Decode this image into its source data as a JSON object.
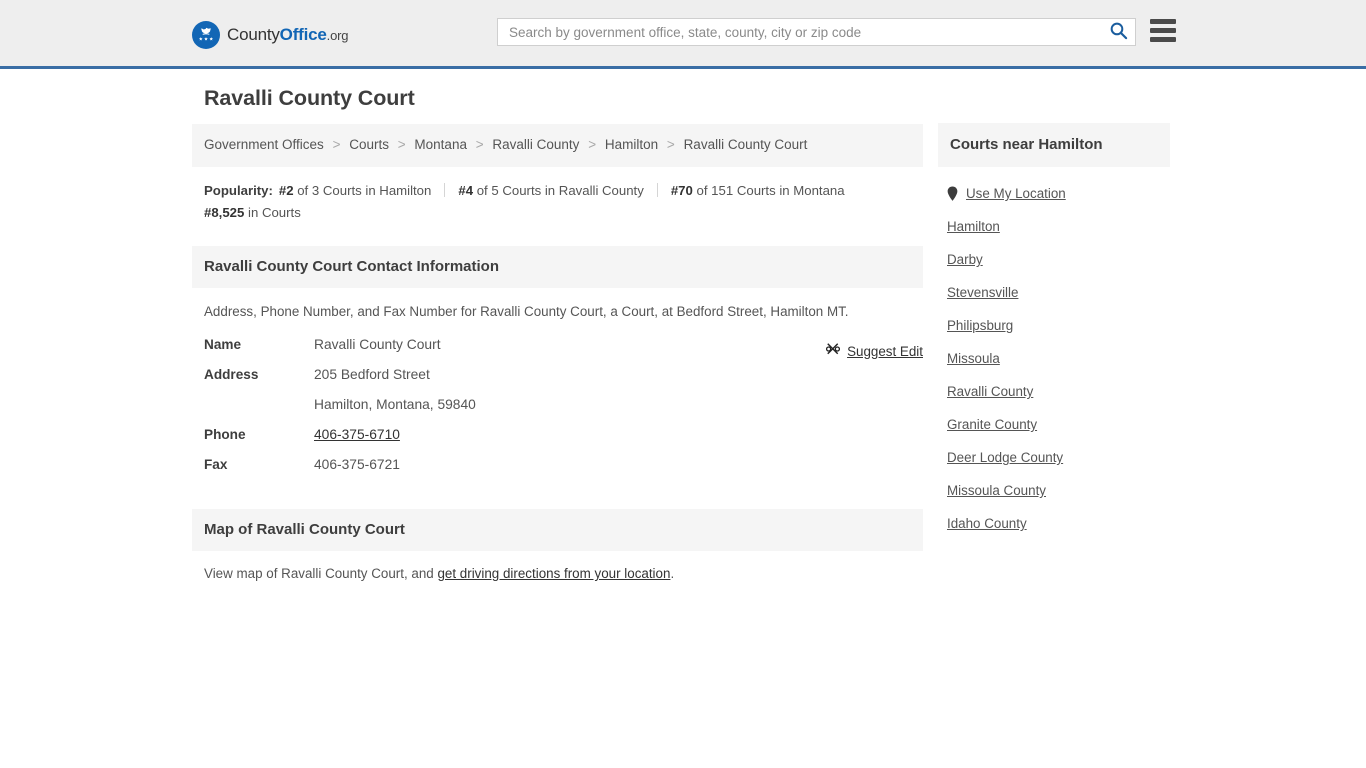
{
  "header": {
    "logo": {
      "icon": "eagle-seal-icon",
      "text_county": "County",
      "text_office": "Office",
      "text_tld": ".org"
    },
    "search": {
      "placeholder": "Search by government office, state, county, city or zip code",
      "value": "",
      "search_icon": "search-icon"
    },
    "menu_icon": "hamburger-menu-icon",
    "accent_color": "#3a6ea5",
    "background_color": "#eeeeee"
  },
  "main": {
    "page_title": "Ravalli County Court",
    "breadcrumb": {
      "separator": ">",
      "items": [
        "Government Offices",
        "Courts",
        "Montana",
        "Ravalli County",
        "Hamilton",
        "Ravalli County Court"
      ]
    },
    "popularity": {
      "label": "Popularity:",
      "items": [
        {
          "rank": "#2",
          "text": "of 3 Courts in Hamilton"
        },
        {
          "rank": "#4",
          "text": "of 5 Courts in Ravalli County"
        },
        {
          "rank": "#70",
          "text": "of 151 Courts in Montana"
        },
        {
          "rank": "#8,525",
          "text": "in Courts"
        }
      ]
    },
    "contact_section": {
      "heading": "Ravalli County Court Contact Information",
      "description": "Address, Phone Number, and Fax Number for Ravalli County Court, a Court, at Bedford Street, Hamilton MT.",
      "suggest_edit": {
        "label": "Suggest Edit",
        "icon": "edit-pencil-icon"
      },
      "rows": [
        {
          "key": "Name",
          "value": "Ravalli County Court",
          "link": false
        },
        {
          "key": "Address",
          "value": "205 Bedford Street",
          "link": false
        },
        {
          "key": "",
          "value": "Hamilton, Montana, 59840",
          "link": false
        },
        {
          "key": "Phone",
          "value": "406-375-6710",
          "link": true
        },
        {
          "key": "Fax",
          "value": "406-375-6721",
          "link": false
        }
      ]
    },
    "map_section": {
      "heading": "Map of Ravalli County Court",
      "text_before": "View map of Ravalli County Court, and ",
      "link_text": "get driving directions from your location",
      "text_after": "."
    }
  },
  "sidebar": {
    "heading": "Courts near Hamilton",
    "use_my_location": {
      "label": "Use My Location",
      "icon": "map-pin-icon"
    },
    "items": [
      {
        "label": "Hamilton"
      },
      {
        "label": "Darby"
      },
      {
        "label": "Stevensville"
      },
      {
        "label": "Philipsburg"
      },
      {
        "label": "Missoula"
      },
      {
        "label": "Ravalli County"
      },
      {
        "label": "Granite County"
      },
      {
        "label": "Deer Lodge County"
      },
      {
        "label": "Missoula County"
      },
      {
        "label": "Idaho County"
      }
    ]
  }
}
